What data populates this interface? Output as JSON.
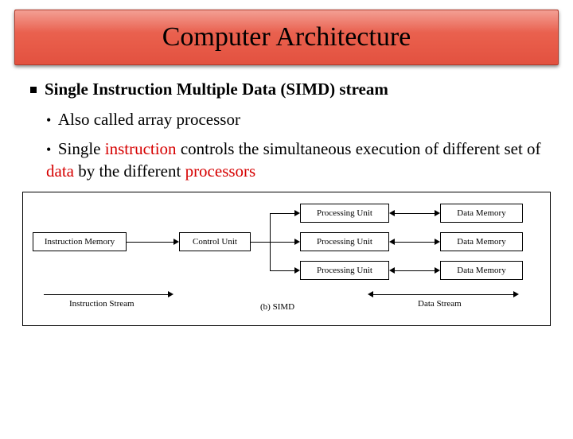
{
  "title": "Computer Architecture",
  "bullet_main": "Single Instruction Multiple Data (SIMD) stream",
  "sub1": {
    "prefix": "• ",
    "text": "Also called array processor"
  },
  "sub2": {
    "prefix": "• ",
    "t1": "Single ",
    "r1": "instruction",
    "t2": " controls the simultaneous execution of different set of ",
    "r2": "data",
    "t3": " by the different ",
    "r3": "processors"
  },
  "diagram": {
    "instruction_memory": "Instruction Memory",
    "control_unit": "Control Unit",
    "processing_unit": "Processing Unit",
    "data_memory": "Data Memory",
    "instruction_stream": "Instruction Stream",
    "data_stream": "Data Stream",
    "caption": "(b) SIMD"
  }
}
